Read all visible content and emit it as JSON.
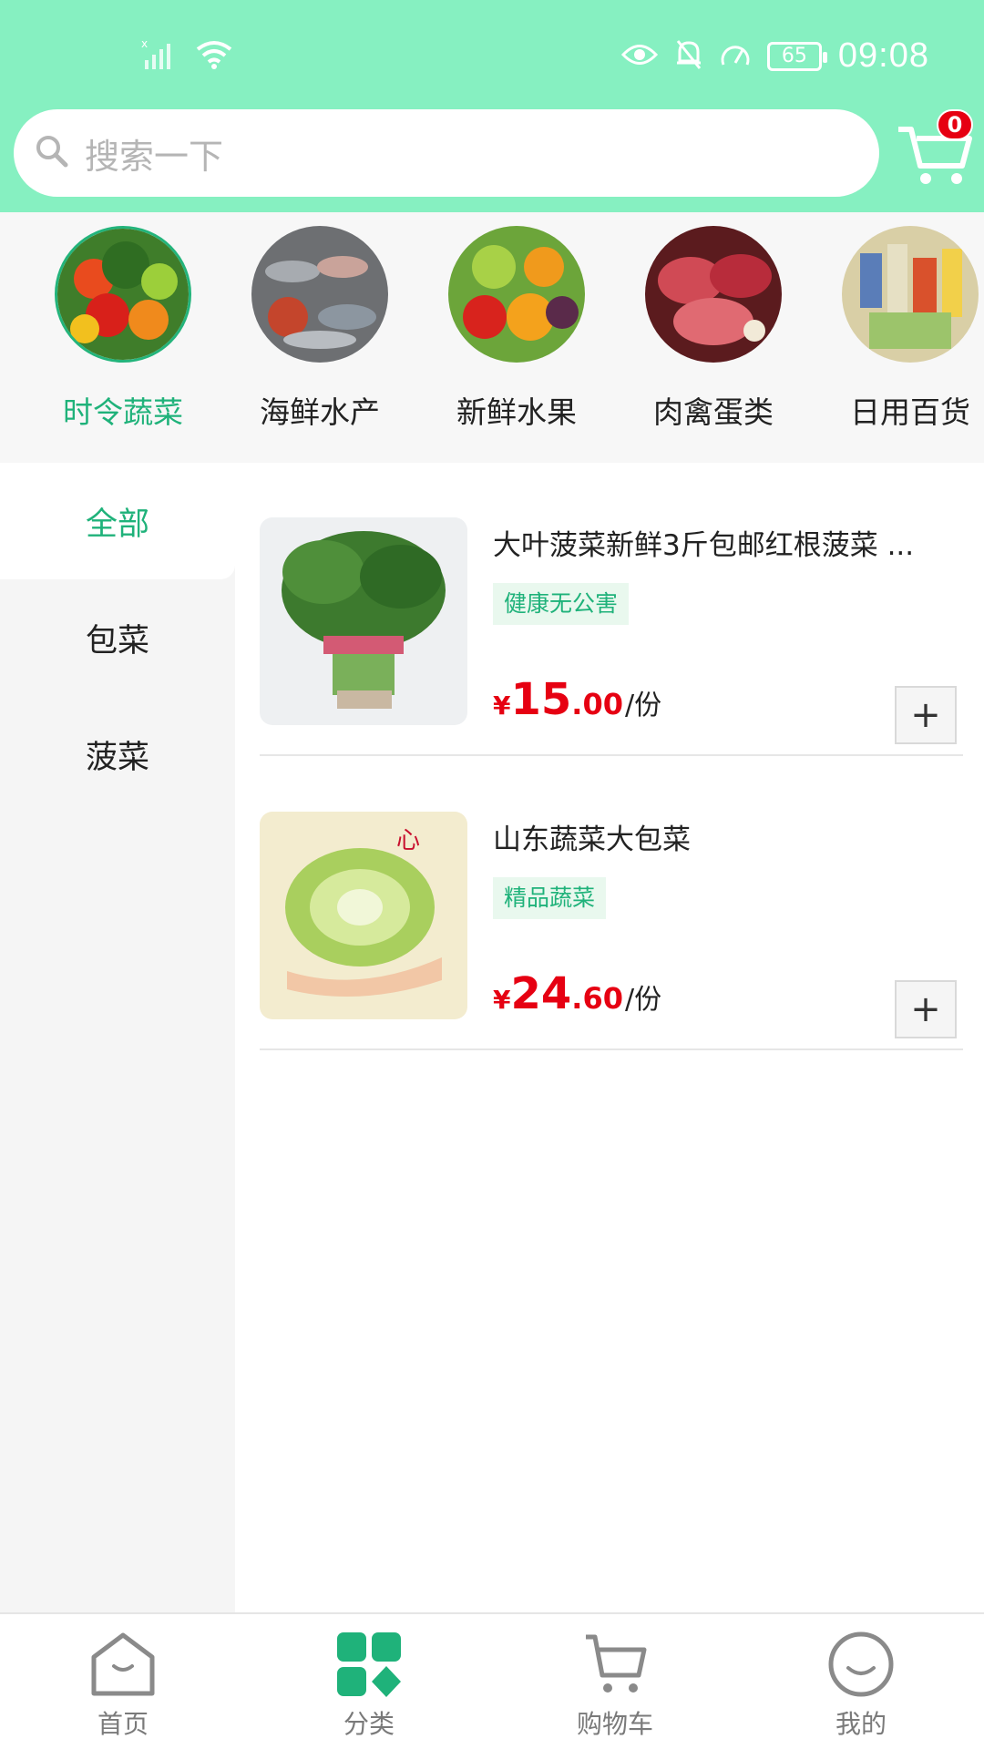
{
  "status_bar": {
    "time": "09:08",
    "battery": "65",
    "icons": [
      "signal-off-icon",
      "wifi-icon",
      "eye-icon",
      "bell-off-icon",
      "speedometer-icon",
      "battery-icon"
    ]
  },
  "search": {
    "placeholder": "搜索一下",
    "icon": "search-icon"
  },
  "cart": {
    "icon": "cart-icon",
    "badge": "0"
  },
  "categories": [
    {
      "label": "时令蔬菜",
      "active": true
    },
    {
      "label": "海鲜水产",
      "active": false
    },
    {
      "label": "新鲜水果",
      "active": false
    },
    {
      "label": "肉禽蛋类",
      "active": false
    },
    {
      "label": "日用百货",
      "active": false
    }
  ],
  "sidebar": {
    "items": [
      {
        "label": "全部",
        "active": true
      },
      {
        "label": "包菜",
        "active": false
      },
      {
        "label": "菠菜",
        "active": false
      }
    ]
  },
  "products": [
    {
      "title": "大叶菠菜新鲜3斤包邮红根菠菜 ...",
      "tag": "健康无公害",
      "price_symbol": "¥",
      "price_int": "15",
      "price_dec": ".00",
      "unit": "/份",
      "add_label": "+"
    },
    {
      "title": "山东蔬菜大包菜",
      "tag": "精品蔬菜",
      "price_symbol": "¥",
      "price_int": "24",
      "price_dec": ".60",
      "unit": "/份",
      "add_label": "+"
    }
  ],
  "bottom_nav": [
    {
      "label": "首页",
      "icon": "home-icon",
      "active": false
    },
    {
      "label": "分类",
      "icon": "category-icon",
      "active": true
    },
    {
      "label": "购物车",
      "icon": "cart-icon",
      "active": false
    },
    {
      "label": "我的",
      "icon": "profile-icon",
      "active": false
    }
  ],
  "colors": {
    "header": "#86f0c1",
    "accent": "#1fb27a",
    "price": "#e60012"
  }
}
